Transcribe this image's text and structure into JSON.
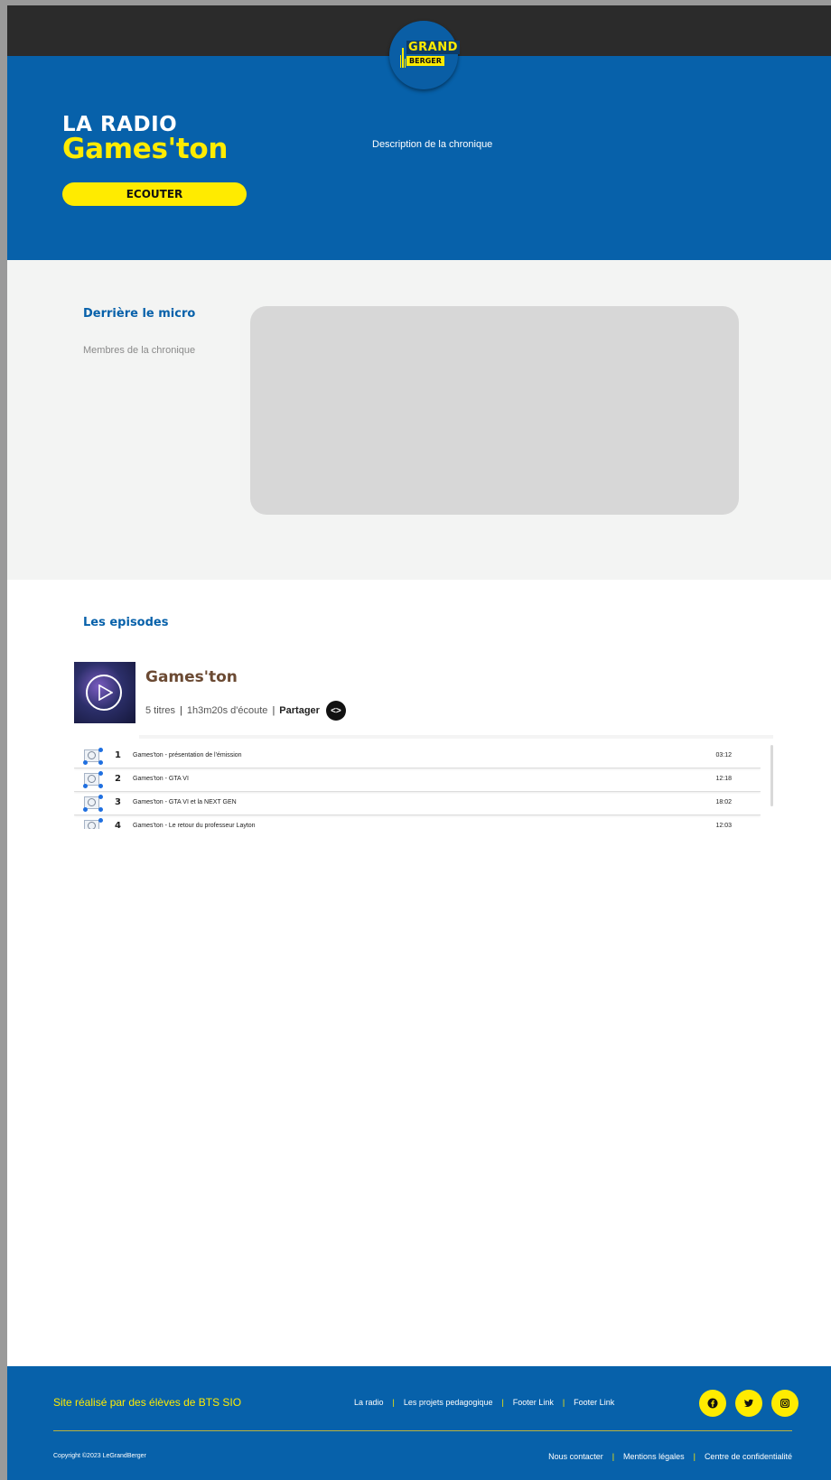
{
  "logo": {
    "line1": "GRAND",
    "line2": "BERGER"
  },
  "hero": {
    "kicker": "LA RADIO",
    "title": "Games'ton",
    "listen_label": "ECOUTER",
    "description": "Description de la chronique"
  },
  "micro": {
    "title": "Derrière le micro",
    "subtitle": "Membres de la chronique"
  },
  "episodes": {
    "title": "Les episodes",
    "playlist": {
      "title": "Games'ton",
      "count": "5 titres",
      "duration": "1h3m20s d'écoute",
      "share_label": "Partager",
      "tracks": [
        {
          "num": "1",
          "title": "Games'ton - présentation de l'émission",
          "duration": "03:12"
        },
        {
          "num": "2",
          "title": "Games'ton - GTA VI",
          "duration": "12:18"
        },
        {
          "num": "3",
          "title": "Games'ton - GTA VI et la NEXT GEN",
          "duration": "18:02"
        },
        {
          "num": "4",
          "title": "Games'ton - Le retour du professeur Layton",
          "duration": "12:03"
        }
      ]
    }
  },
  "footer": {
    "credit": "Site réalisé par des élèves de BTS SIO",
    "nav": [
      "La radio",
      "Les projets pedagogique",
      "Footer Link",
      "Footer Link"
    ],
    "social": [
      "facebook-icon",
      "twitter-icon",
      "instagram-icon"
    ],
    "copyright": "Copyright ©2023 LeGrandBerger",
    "legal": [
      "Nous contacter",
      "Mentions légales",
      "Centre de confidentialité"
    ]
  },
  "colors": {
    "primary_blue": "#0761aa",
    "accent_yellow": "#ffeb00",
    "topbar": "#2b2b2b",
    "light_section": "#f3f4f3"
  }
}
